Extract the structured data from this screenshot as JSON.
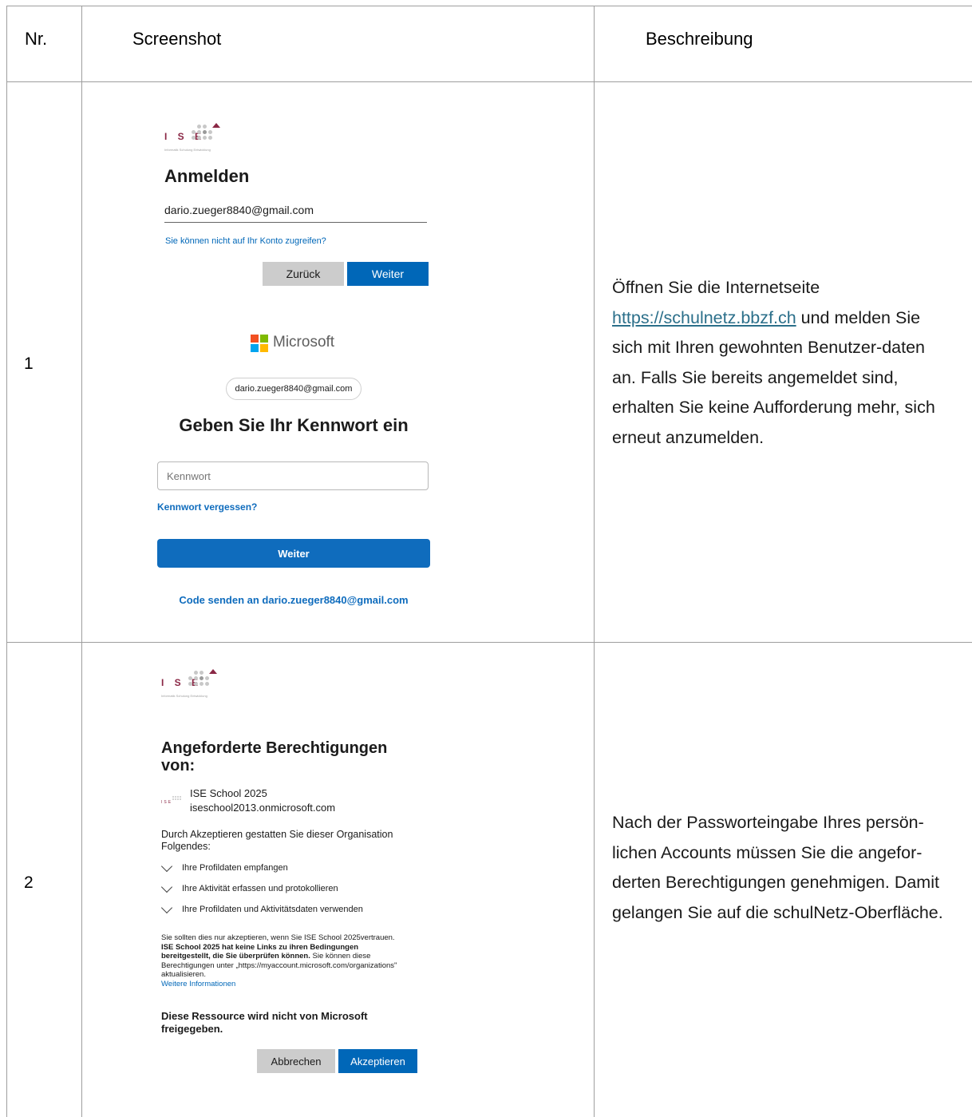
{
  "table": {
    "headers": {
      "nr": "Nr.",
      "screenshot": "Screenshot",
      "description": "Beschreibung"
    }
  },
  "row1": {
    "nr": "1",
    "login": {
      "org_logo_letters": "I S E",
      "org_logo_tagline": "Informatik Schulung Entwicklung",
      "title": "Anmelden",
      "email_value": "dario.zueger8840@gmail.com",
      "cant_access_link": "Sie können nicht auf Ihr Konto zugreifen?",
      "back_button": "Zurück",
      "next_button": "Weiter"
    },
    "password": {
      "brand": "Microsoft",
      "email_chip": "dario.zueger8840@gmail.com",
      "title": "Geben Sie Ihr Kennwort ein",
      "password_placeholder": "Kennwort",
      "forgot_link": "Kennwort vergessen?",
      "next_button": "Weiter",
      "send_code_link": "Code senden an dario.zueger8840@gmail.com"
    },
    "description": {
      "part1": "Öffnen Sie die Internetseite",
      "link": "https://schulnetz.bbzf.ch",
      "part2": "und melden Sie sich mit Ihren gewohnten Benutzer-daten an. Falls Sie bereits angemeldet sind, erhalten Sie keine Aufforderung mehr, sich erneut anzumelden."
    }
  },
  "row2": {
    "nr": "2",
    "consent": {
      "org_logo_letters": "I S E",
      "org_logo_tagline": "Informatik Schulung Entwicklung",
      "title": "Angeforderte Berechtigungen von:",
      "app_name": "ISE School 2025",
      "app_domain": "iseschool2013.onmicrosoft.com",
      "intro": "Durch Akzeptieren gestatten Sie dieser Organisation Folgendes:",
      "permissions": [
        "Ihre Profildaten empfangen",
        "Ihre Aktivität erfassen und protokollieren",
        "Ihre Profildaten und Aktivitätsdaten verwenden"
      ],
      "notice_1": "Sie sollten dies nur akzeptieren, wenn Sie ISE School 2025vertrauen. ",
      "notice_bold": "ISE School 2025 hat keine Links zu ihren Bedingungen bereitgestellt, die Sie überprüfen können.",
      "notice_2": " Sie können diese Berechtigungen unter „https://myaccount.microsoft.com/organizations\" aktualisieren.",
      "more_info_link": "Weitere Informationen",
      "warning": "Diese Ressource wird nicht von Microsoft freigegeben.",
      "cancel_button": "Abbrechen",
      "accept_button": "Akzeptieren"
    },
    "description": "Nach der Passworteingabe Ihres persön-lichen Accounts müssen Sie die angefor-derten Berechtigungen genehmigen. Damit gelangen Sie auf die schulNetz-Oberfläche."
  },
  "colors": {
    "ms_blue": "#0067b8",
    "ise_red": "#8a2745",
    "link_teal": "#2b6f8a"
  }
}
